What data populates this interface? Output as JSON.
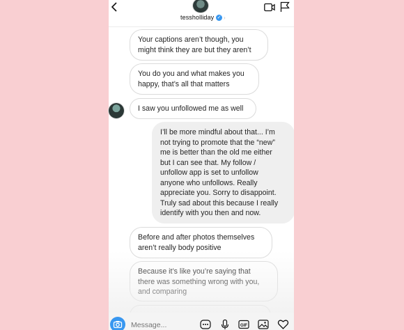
{
  "header": {
    "username": "tessholliday",
    "back_icon": "chevron-left-icon",
    "verified_icon": "verified-badge-icon",
    "actions": [
      "video-call-icon",
      "flag-icon"
    ]
  },
  "messages": [
    {
      "direction": "in",
      "text": "Your captions aren’t though, you\nmight think they are but they aren’t"
    },
    {
      "direction": "in",
      "text": "You do you and what makes you\nhappy, that’s all that matters"
    },
    {
      "direction": "in",
      "text": "I saw you unfollowed me as well"
    },
    {
      "direction": "out",
      "text": "I’ll be more mindful about that...  I’m\nnot trying to promote that the “new”\nme is better than the old me either\nbut I can see that. My follow /\nunfollow app is set to unfollow\nanyone who unfollows. Really\nappreciate you. Sorry to disappoint.\nTruly sad about this because I really\nidentify with you then and now."
    },
    {
      "direction": "in",
      "text": "Before and after photos themselves\naren’t really body positive"
    },
    {
      "direction": "in",
      "text": "Because it’s like you’re saying that\nthere was something wrong with you,\nand comparing"
    }
  ],
  "composer": {
    "placeholder": "Message...",
    "icons": [
      "camera-icon",
      "more-icon",
      "microphone-icon",
      "gif-icon",
      "image-icon",
      "heart-icon"
    ]
  },
  "colors": {
    "background": "#f9cfd2",
    "accent": "#3897f0",
    "bubble_border": "#dbdbdb",
    "outgoing_bubble": "#efefef"
  }
}
